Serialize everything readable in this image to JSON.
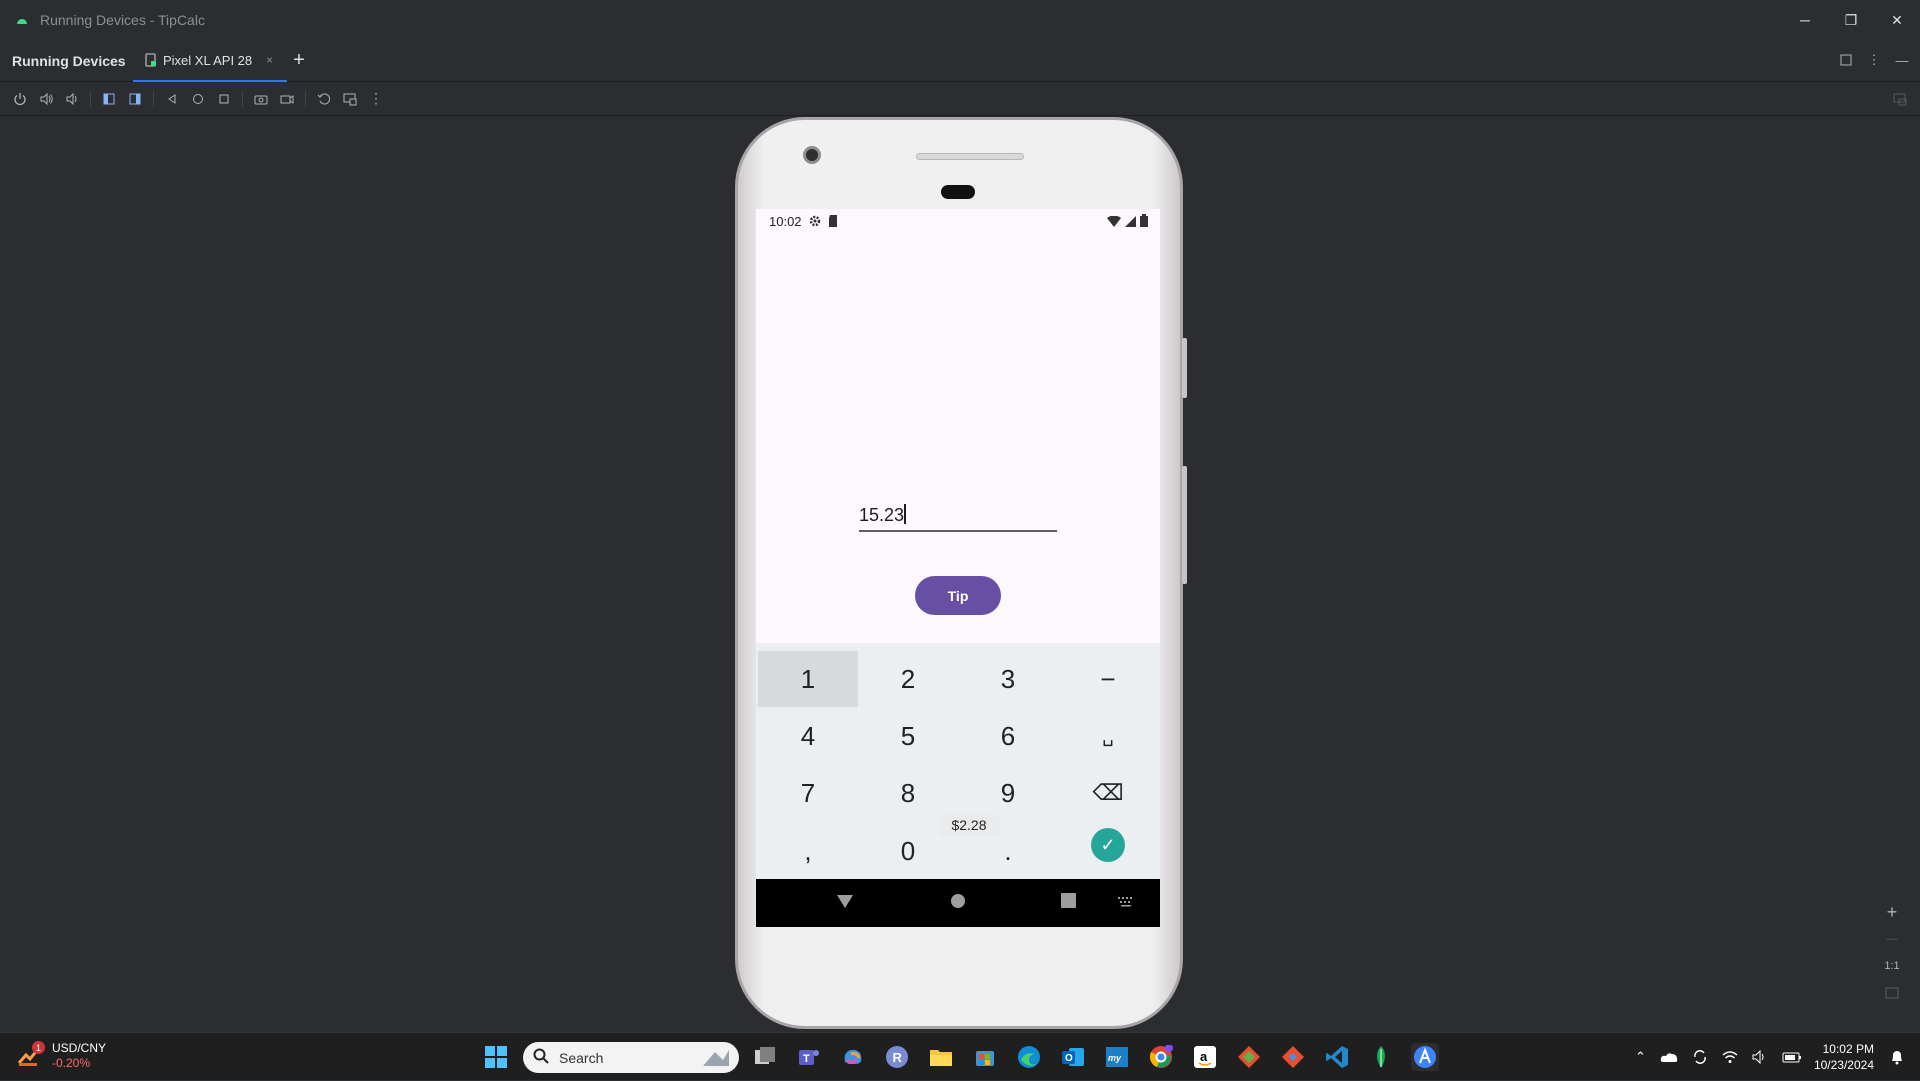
{
  "window": {
    "title": "Running Devices - TipCalc",
    "minimize": "─",
    "restore": "❐",
    "close": "✕"
  },
  "tool_window": {
    "title": "Running Devices",
    "tab_label": "Pixel XL API 28",
    "tab_close": "×",
    "add_tab": "+"
  },
  "device": {
    "status_time": "10:02",
    "amount_value": "15.23",
    "tip_button_label": "Tip",
    "keys": [
      {
        "label": "1"
      },
      {
        "label": "2"
      },
      {
        "label": "3"
      },
      {
        "label": "−"
      },
      {
        "label": "4"
      },
      {
        "label": "5"
      },
      {
        "label": "6"
      },
      {
        "label": "␣"
      },
      {
        "label": "7"
      },
      {
        "label": "8"
      },
      {
        "label": "9"
      },
      {
        "label": "⌫"
      },
      {
        "label": ","
      },
      {
        "label": "0"
      },
      {
        "label": "."
      },
      {
        "label": "✓"
      }
    ],
    "toast": "$2.28"
  },
  "zoom": {
    "zoom_in": "+",
    "zoom_out": "—",
    "actual_size": "1:1"
  },
  "taskbar": {
    "ticker_symbol": "USD/CNY",
    "ticker_change": "-0.20%",
    "weather_badge": "1",
    "search_placeholder": "Search",
    "clock_time": "10:02 PM",
    "clock_date": "10/23/2024"
  },
  "colors": {
    "accent": "#3574f0",
    "tip_button": "#6750a4",
    "done_key": "#26a69a",
    "ticker_down": "#ff6b6b"
  }
}
